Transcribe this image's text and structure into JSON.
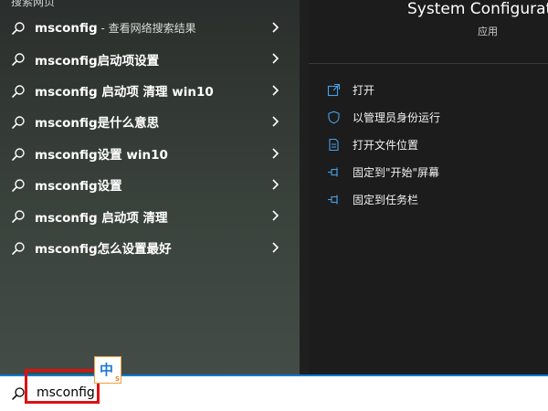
{
  "left": {
    "section_header": "搜索网页",
    "suggestions": [
      {
        "label": "msconfig",
        "sublabel": " - 查看网络搜索结果"
      },
      {
        "label": "msconfig启动项设置",
        "sublabel": ""
      },
      {
        "label": "msconfig 启动项 清理 win10",
        "sublabel": ""
      },
      {
        "label": "msconfig是什么意思",
        "sublabel": ""
      },
      {
        "label": "msconfig设置 win10",
        "sublabel": ""
      },
      {
        "label": "msconfig设置",
        "sublabel": ""
      },
      {
        "label": "msconfig 启动项 清理",
        "sublabel": ""
      },
      {
        "label": "msconfig怎么设置最好",
        "sublabel": ""
      }
    ]
  },
  "right": {
    "app_title": "System Configurati",
    "app_subtitle": "应用",
    "actions": [
      {
        "label": "打开",
        "icon": "open-icon"
      },
      {
        "label": "以管理员身份运行",
        "icon": "shield-icon"
      },
      {
        "label": "打开文件位置",
        "icon": "file-location-icon"
      },
      {
        "label": "固定到\"开始\"屏幕",
        "icon": "pin-icon"
      },
      {
        "label": "固定到任务栏",
        "icon": "pin-icon"
      }
    ]
  },
  "search": {
    "value": "msconfig"
  },
  "ime": {
    "char": "中",
    "small": "S"
  },
  "colors": {
    "highlight": "#e01010",
    "accent": "#0078d4"
  }
}
